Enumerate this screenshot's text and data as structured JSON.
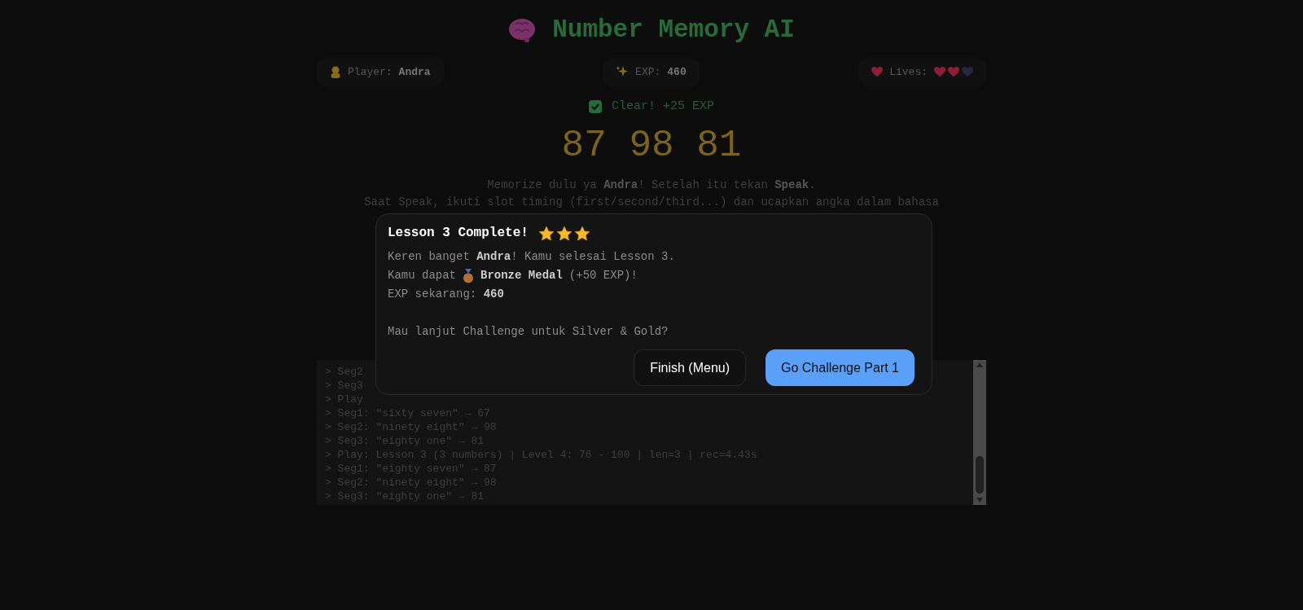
{
  "title": "Number Memory AI",
  "stats": [
    {
      "kind": "player",
      "label": "Player:",
      "value": "Andra"
    },
    {
      "kind": "exp",
      "label": "EXP:",
      "value": "460"
    },
    {
      "kind": "lives",
      "label": "Lives:",
      "hearts": [
        {
          "filled": true
        },
        {
          "filled": true
        },
        {
          "filled": false
        }
      ]
    }
  ],
  "feedback": {
    "checked": true,
    "text": "Clear! +25 EXP"
  },
  "numbers": "87 98 81",
  "instructions": [
    "Memorize dulu ya **Andra**! Setelah itu tekan **Speak**.",
    "Saat Speak, ikuti slot timing (first/second/third...) dan ucapkan angka dalam bahasa"
  ],
  "log": [
    "> Seg2",
    "> Seg3",
    "> Play",
    "> Seg1: \"sixty seven\" → 67",
    "> Seg2: \"ninety eight\" → 98",
    "> Seg3: \"eighty one\" → 81",
    "> Play: Lesson 3 (3 numbers) | Level 4: 76 - 100 | len=3 | rec=4.43s",
    "> Seg1: \"eighty seven\" → 87",
    "> Seg2: \"ninety eight\" → 98",
    "> Seg3: \"eighty one\" → 81"
  ],
  "dialog": {
    "title": "Lesson 3 Complete!",
    "stars": 3,
    "lines": [
      "Keren banget **Andra**! Kamu selesai Lesson 3."
    ],
    "medal_line": {
      "before": "Kamu dapat",
      "medal": "Bronze Medal",
      "after": "(+50 EXP)!"
    },
    "exp_line": "EXP sekarang: **460**",
    "question": "Mau lanjut Challenge untuk Silver & Gold?",
    "buttons": [
      {
        "kind": "secondary",
        "label": "Finish (Menu)"
      },
      {
        "kind": "primary",
        "label": "Go Challenge Part 1"
      }
    ]
  }
}
